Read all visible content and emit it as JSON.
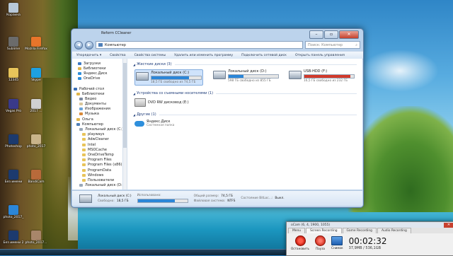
{
  "desktop": {
    "icons": [
      {
        "label": "Корзина"
      },
      {
        "label": "Sublime"
      },
      {
        "label": "Mozilla Firefox"
      },
      {
        "label": "12345"
      },
      {
        "label": "Skype"
      },
      {
        "label": "Vegas Pro"
      },
      {
        "label": "2017 ..."
      },
      {
        "label": "Photoshop"
      },
      {
        "label": "photo_2017"
      },
      {
        "label": "Без имени"
      },
      {
        "label": "BandiCam"
      },
      {
        "label": "photo_2017_"
      },
      {
        "label": "Без имени 2"
      },
      {
        "label": "photo_2017..."
      }
    ]
  },
  "explorer": {
    "window_title": "Reform CCleaner",
    "address": "Компьютер",
    "search_placeholder": "Поиск: Компьютер",
    "window_buttons": {
      "min": "–",
      "max": "▫",
      "close": "✕"
    },
    "toolbar": [
      "Упорядочить ▾",
      "Свойства",
      "Свойства системы",
      "Удалить или изменить программу",
      "Подключить сетевой диск",
      "Открыть панель управления"
    ],
    "nav_items": [
      {
        "label": "Загрузки",
        "color": "#3b78c4",
        "indent": 8
      },
      {
        "label": "Библиотеки",
        "color": "#e0b64c",
        "indent": 8
      },
      {
        "label": "Яндекс.Диск",
        "color": "#2e8fdc",
        "indent": 8
      },
      {
        "label": "OneDrive",
        "color": "#2e8fdc",
        "indent": 8
      },
      {
        "label": "",
        "color": "transparent",
        "indent": 0
      },
      {
        "label": "Рабочий стол",
        "color": "#3a6fb8",
        "indent": 2
      },
      {
        "label": "Библиотеки",
        "color": "#e0b64c",
        "indent": 6
      },
      {
        "label": "Видео",
        "color": "#7c8aa0",
        "indent": 10
      },
      {
        "label": "Документы",
        "color": "#d9c69a",
        "indent": 10
      },
      {
        "label": "Изображения",
        "color": "#6aa3d8",
        "indent": 10
      },
      {
        "label": "Музыка",
        "color": "#d88a3a",
        "indent": 10
      },
      {
        "label": "Ольга",
        "color": "#e0b64c",
        "indent": 6
      },
      {
        "label": "Компьютер",
        "color": "#4e7fb8",
        "indent": 6
      },
      {
        "label": "Локальный диск (C:)",
        "color": "#9aa8b8",
        "indent": 10
      },
      {
        "label": "playways",
        "color": "#e8c45a",
        "indent": 14
      },
      {
        "label": "AdwCleaner",
        "color": "#e8c45a",
        "indent": 14
      },
      {
        "label": "Intel",
        "color": "#e8c45a",
        "indent": 14
      },
      {
        "label": "MSOCache",
        "color": "#e8c45a",
        "indent": 14
      },
      {
        "label": "OneDriveTemp",
        "color": "#e8c45a",
        "indent": 14
      },
      {
        "label": "Program Files",
        "color": "#e8c45a",
        "indent": 14
      },
      {
        "label": "Program Files (x86)",
        "color": "#e8c45a",
        "indent": 14
      },
      {
        "label": "ProgramData",
        "color": "#e8c45a",
        "indent": 14
      },
      {
        "label": "Windows",
        "color": "#e8c45a",
        "indent": 14
      },
      {
        "label": "Пользователи",
        "color": "#e8c45a",
        "indent": 14
      },
      {
        "label": "Локальный диск (D:)",
        "color": "#9aa8b8",
        "indent": 10
      }
    ],
    "sections": {
      "hard_drives": "Жесткие диски (3)",
      "removable": "Устройства со съемными носителями (1)",
      "other": "Другие (1)"
    },
    "drives": [
      {
        "name": "Локальный диск (C:)",
        "free": "18,5 ГБ свободно из 74,5 ГБ",
        "used_fraction": 0.75,
        "color": "#2b86d8"
      },
      {
        "name": "Локальный диск (D:)",
        "free": "598 ГБ свободно из 855 ГБ",
        "used_fraction": 0.3,
        "color": "#2b86d8"
      },
      {
        "name": "USB-HDD (F:)",
        "free": "16,5 ГБ свободно из 232 ГБ",
        "used_fraction": 0.93,
        "color": "#d23a2b"
      }
    ],
    "dvd": {
      "name": "DVD RW дисковод (E:)"
    },
    "yandex": {
      "name": "Яндекс.Диск",
      "sub": "Системная папка"
    },
    "status": {
      "name": "Локальный диск (C:)",
      "used_label": "Использовано:",
      "used_fraction": 0.75,
      "free_label": "Свободно:",
      "free_value": "18,5 ГБ",
      "total_label": "Общий размер:",
      "total_value": "74,5 ГБ",
      "fs_label": "Файловая система:",
      "fs_value": "NTFS",
      "bitlocker_label": "Состояние BitLoc...:",
      "bitlocker_value": "Выкл."
    }
  },
  "ocam": {
    "title": "oCam (6, 4, 1900, 1055)",
    "close": "✕",
    "tabs": [
      "Menu",
      "Screen Recording",
      "Game Recording",
      "Audio Recording"
    ],
    "stop_label": "Остановить",
    "pause_label": "Пауза",
    "snap_label": "Снимок",
    "time": "00:02:32",
    "size": "37,9MB / 536,1GB"
  }
}
